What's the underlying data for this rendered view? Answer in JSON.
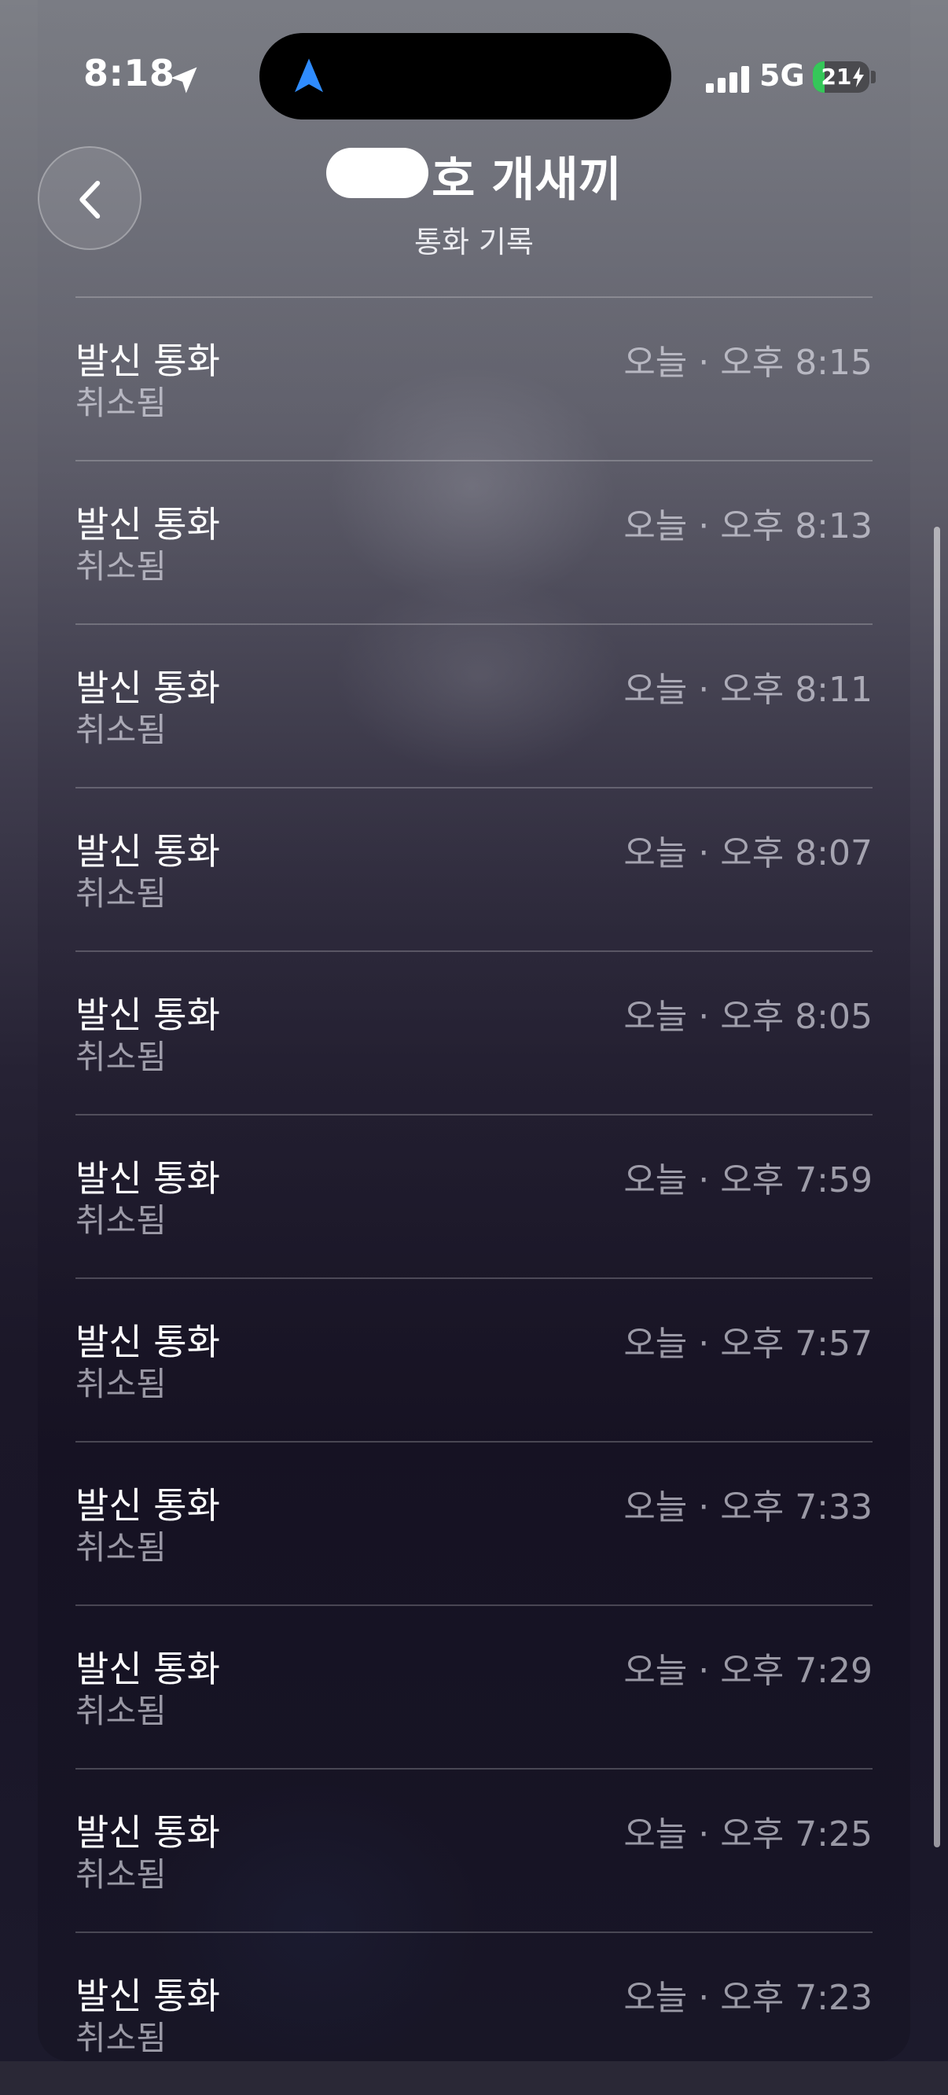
{
  "status_bar": {
    "time": "8:18",
    "network": "5G",
    "battery_percent": 21,
    "battery_text": "21",
    "accent_color": "#35c759"
  },
  "header": {
    "title": "호 개새끼",
    "subtitle": "통화 기록"
  },
  "icons": {
    "back": "chevron-left-icon",
    "location": "location-arrow-icon",
    "navigation": "navigation-arrow-icon",
    "signal": "cellular-signal-icon",
    "battery": "battery-charging-icon"
  },
  "calls": [
    {
      "type": "발신 통화",
      "status": "취소됨",
      "time": "오늘 · 오후 8:15"
    },
    {
      "type": "발신 통화",
      "status": "취소됨",
      "time": "오늘 · 오후 8:13"
    },
    {
      "type": "발신 통화",
      "status": "취소됨",
      "time": "오늘 · 오후 8:11"
    },
    {
      "type": "발신 통화",
      "status": "취소됨",
      "time": "오늘 · 오후 8:07"
    },
    {
      "type": "발신 통화",
      "status": "취소됨",
      "time": "오늘 · 오후 8:05"
    },
    {
      "type": "발신 통화",
      "status": "취소됨",
      "time": "오늘 · 오후 7:59"
    },
    {
      "type": "발신 통화",
      "status": "취소됨",
      "time": "오늘 · 오후 7:57"
    },
    {
      "type": "발신 통화",
      "status": "취소됨",
      "time": "오늘 · 오후 7:33"
    },
    {
      "type": "발신 통화",
      "status": "취소됨",
      "time": "오늘 · 오후 7:29"
    },
    {
      "type": "발신 통화",
      "status": "취소됨",
      "time": "오늘 · 오후 7:25"
    },
    {
      "type": "발신 통화",
      "status": "취소됨",
      "time": "오늘 · 오후 7:23"
    }
  ]
}
